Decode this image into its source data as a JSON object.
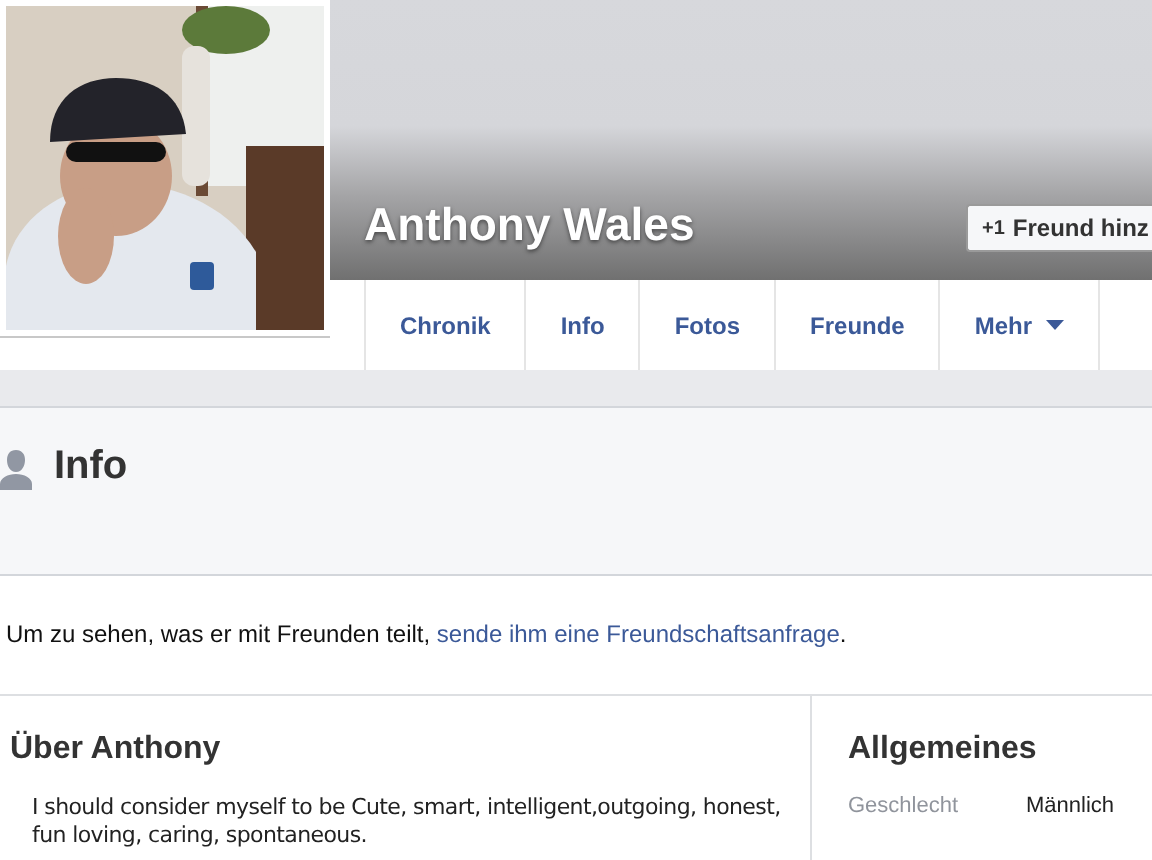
{
  "profile": {
    "name": "Anthony Wales",
    "add_friend_button": {
      "icon": "+1",
      "label": "Freund hinz"
    }
  },
  "tabs": [
    {
      "label": "Chronik",
      "selected": false
    },
    {
      "label": "Info",
      "selected": false
    },
    {
      "label": "Fotos",
      "selected": false
    },
    {
      "label": "Freunde",
      "selected": false
    },
    {
      "label": "Mehr",
      "selected": false,
      "dropdown": true
    }
  ],
  "section": {
    "title": "Info"
  },
  "notice": {
    "text": "Um zu sehen, was er mit Freunden teilt, ",
    "link": "sende ihm eine Freundschaftsanfrage",
    "end": "."
  },
  "about": {
    "title": "Über Anthony",
    "lines": [
      "I should consider myself to be Cute, smart, intelligent,outgoing, honest,",
      "fun loving, caring, spontaneous."
    ]
  },
  "general": {
    "title": "Allgemeines",
    "rows": [
      {
        "label": "Geschlecht",
        "value": "Männlich"
      }
    ]
  }
}
